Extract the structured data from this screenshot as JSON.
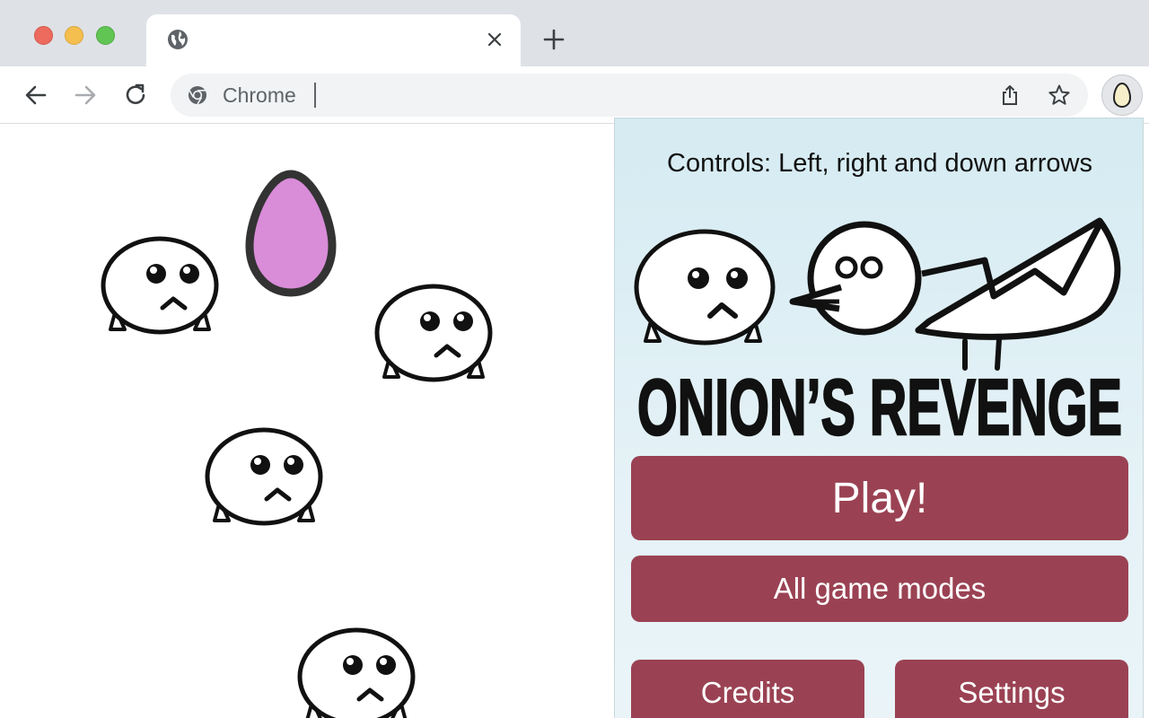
{
  "browser": {
    "tab": {
      "title": "",
      "favicon_icon": "globe-icon",
      "close_icon": "close-icon"
    },
    "new_tab_icon": "plus-icon",
    "omnibox": {
      "site_label": "Chrome",
      "value": ""
    },
    "extension_icon": "egg-icon"
  },
  "popup": {
    "controls_text": "Controls: Left, right and down arrows",
    "logo_title": "ONION’S REVENGE",
    "buttons": {
      "play": "Play!",
      "all_modes": "All game modes",
      "credits": "Credits",
      "settings": "Settings"
    },
    "button_color": "#9a4253"
  },
  "game": {
    "egg_color": "#d98cd8"
  }
}
